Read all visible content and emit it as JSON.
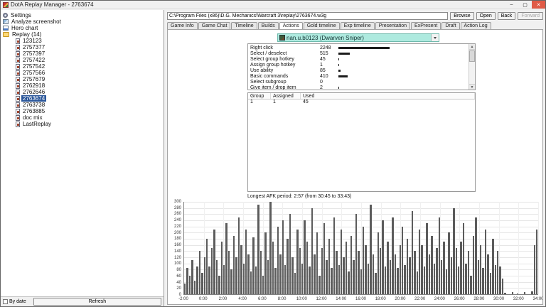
{
  "window": {
    "title": "DotA Replay Manager - 2763674",
    "minimize": "–",
    "maximize": "▢",
    "close": "✕"
  },
  "toolbar": {
    "path": "C:\\Program Files (x86)\\D.G. Mechanics\\Warcraft 3\\replay\\2763674.w3g",
    "browse_label": "Browse",
    "open_label": "Open",
    "back_label": "Back",
    "forward_label": "Forward"
  },
  "tabs": [
    {
      "label": "Game Info",
      "active": false
    },
    {
      "label": "Game Chat",
      "active": false
    },
    {
      "label": "Timeline",
      "active": false
    },
    {
      "label": "Builds",
      "active": false
    },
    {
      "label": "Actions",
      "active": true
    },
    {
      "label": "Gold timeline",
      "active": false
    },
    {
      "label": "Exp timeline",
      "active": false
    },
    {
      "label": "Presentation",
      "active": false
    },
    {
      "label": "ExPresent",
      "active": false
    },
    {
      "label": "Draft",
      "active": false
    },
    {
      "label": "Action Log",
      "active": false
    }
  ],
  "sidebar": {
    "items": [
      {
        "label": "Settings",
        "icon": "settings-icon"
      },
      {
        "label": "Analyze screenshot",
        "icon": "screenshot-icon"
      },
      {
        "label": "Hero chart",
        "icon": "chart-icon"
      },
      {
        "label": "Replay (14)",
        "icon": "folder-icon",
        "expanded": true
      }
    ],
    "replays": [
      {
        "label": "123123"
      },
      {
        "label": "2757377"
      },
      {
        "label": "2757397"
      },
      {
        "label": "2757422"
      },
      {
        "label": "2757542"
      },
      {
        "label": "2757566"
      },
      {
        "label": "2757679"
      },
      {
        "label": "2762918"
      },
      {
        "label": "2762646"
      },
      {
        "label": "2763674",
        "selected": true
      },
      {
        "label": "2763738"
      },
      {
        "label": "2763885"
      },
      {
        "label": "doc mix"
      },
      {
        "label": "LastReplay"
      }
    ],
    "by_date_label": "By date",
    "refresh_label": "Refresh"
  },
  "player_select": {
    "value": "nan.u.b0123 (Dwarven Sniper)"
  },
  "action_counts": {
    "rows": [
      {
        "label": "Right click",
        "value": 2248
      },
      {
        "label": "Select / deselect",
        "value": 515
      },
      {
        "label": "Select group hotkey",
        "value": 45
      },
      {
        "label": "Assign group hotkey",
        "value": 1
      },
      {
        "label": "Use ability",
        "value": 85
      },
      {
        "label": "Basic commands",
        "value": 410
      },
      {
        "label": "Select subgroup",
        "value": 0
      },
      {
        "label": "Give item / drop item",
        "value": 2
      }
    ],
    "max_value": 2248
  },
  "group_table": {
    "headers": [
      "Group",
      "Assigned",
      "Used"
    ],
    "rows": [
      [
        "1",
        "1",
        "45"
      ]
    ]
  },
  "afk_text": "Longest AFK period: 2:57 (from 30:45 to 33:43)",
  "chart_data": {
    "type": "bar",
    "title": "",
    "xlabel": "",
    "ylabel": "",
    "ylim": [
      0,
      300
    ],
    "y_tick_step": 20,
    "x_ticks": [
      "-2:00",
      "0:00",
      "2:00",
      "4:00",
      "6:00",
      "8:00",
      "10:00",
      "12:00",
      "14:00",
      "16:00",
      "18:00",
      "20:00",
      "22:00",
      "24:00",
      "26:00",
      "28:00",
      "30:00",
      "32:00",
      "34:00"
    ],
    "bar_interval_seconds": 15,
    "x_start_seconds": -120,
    "grid": true,
    "values": [
      35,
      85,
      60,
      110,
      45,
      90,
      140,
      70,
      120,
      180,
      90,
      150,
      210,
      110,
      60,
      170,
      95,
      230,
      140,
      80,
      190,
      120,
      250,
      160,
      100,
      210,
      130,
      75,
      185,
      90,
      290,
      140,
      60,
      200,
      110,
      300,
      170,
      85,
      220,
      130,
      240,
      95,
      180,
      260,
      120,
      70,
      210,
      150,
      100,
      240,
      170,
      90,
      280,
      130,
      200,
      60,
      150,
      230,
      110,
      180,
      85,
      250,
      140,
      95,
      210,
      120,
      170,
      75,
      190,
      110,
      260,
      140,
      80,
      220,
      160,
      100,
      290,
      130,
      70,
      200,
      150,
      240,
      90,
      170,
      110,
      250,
      130,
      85,
      160,
      220,
      95,
      180,
      120,
      270,
      140,
      75,
      210,
      160,
      90,
      230,
      130,
      190,
      100,
      150,
      250,
      110,
      170,
      80,
      200,
      120,
      280,
      150,
      90,
      170,
      230,
      100,
      140,
      60,
      190,
      250,
      110,
      160,
      85,
      210,
      130,
      70,
      180,
      95,
      140,
      90,
      50,
      5,
      0,
      0,
      8,
      0,
      3,
      0,
      0,
      6,
      0,
      0,
      10,
      160,
      210
    ]
  },
  "colors": {
    "selection": "#2b579a",
    "combo_highlight": "#aeeadf",
    "chart_bar": "#5c5c5c",
    "close_button": "#e05a46"
  }
}
